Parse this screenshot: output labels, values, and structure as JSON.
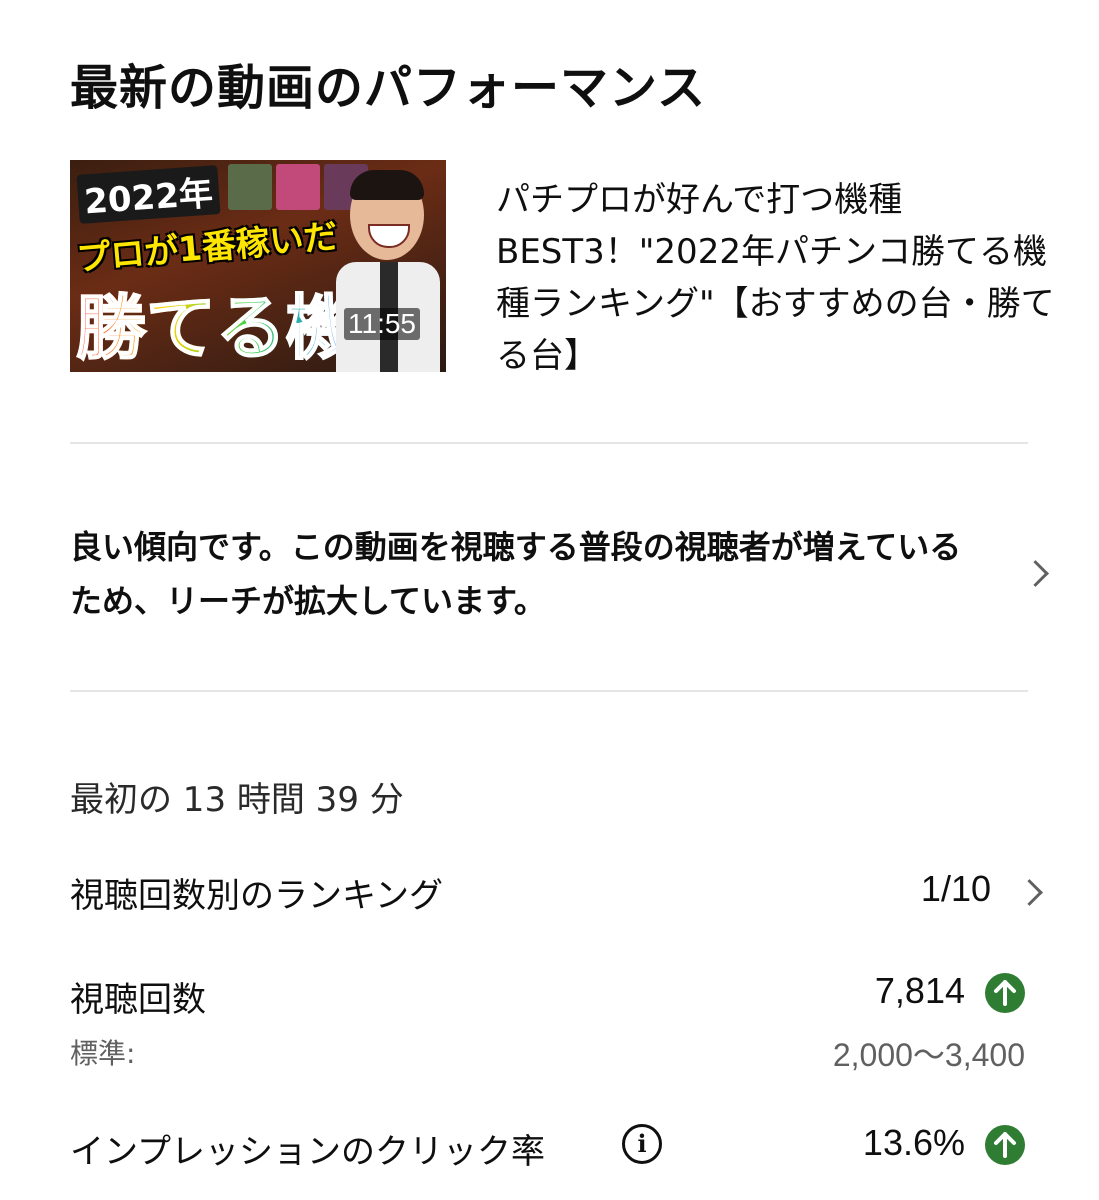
{
  "header": {
    "title": "最新の動画のパフォーマンス"
  },
  "video": {
    "thumbnail_text": {
      "year": "2022年",
      "line2": "プロが1番稼いだ",
      "line3": "勝てる機種"
    },
    "duration": "11:55",
    "title": "パチプロが好んで打つ機種BEST3！\"2022年パチンコ勝てる機種ランキング\"【おすすめの台・勝てる台】"
  },
  "insight": {
    "text": "良い傾向です。この動画を視聴する普段の視聴者が増えているため、リーチが拡大しています。"
  },
  "metrics": {
    "period": "最初の 13 時間 39 分",
    "ranking": {
      "label": "視聴回数別のランキング",
      "value": "1/10"
    },
    "views": {
      "label": "視聴回数",
      "value": "7,814",
      "typical_label": "標準:",
      "typical_range": "2,000〜3,400",
      "trend": "up"
    },
    "ctr": {
      "label": "インプレッションのクリック率",
      "value": "13.6%",
      "trend": "up"
    }
  },
  "colors": {
    "trend_up": "#2e7d32",
    "divider": "#e5e5e5",
    "secondary_text": "#606060"
  },
  "icons": {
    "chevron": "chevron-right-icon",
    "trend_up": "arrow-up-circle-icon",
    "info": "info-icon"
  }
}
